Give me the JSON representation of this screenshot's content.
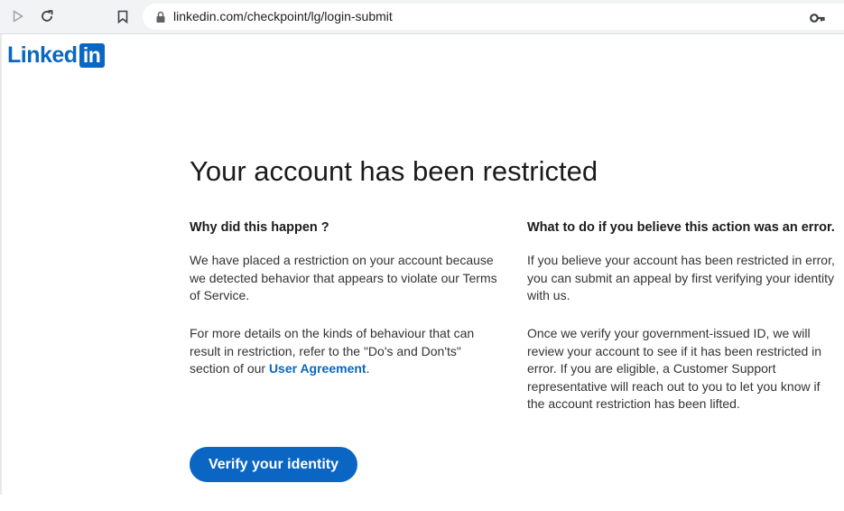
{
  "browser": {
    "url": "linkedin.com/checkpoint/lg/login-submit",
    "icons": [
      "play-icon",
      "reload-icon",
      "bookmark-icon",
      "lock-icon",
      "key-icon"
    ]
  },
  "logo": {
    "text": "Linked",
    "box_text": "in",
    "color": "#0a66c2"
  },
  "main": {
    "title": "Your account has been restricted",
    "left": {
      "heading": "Why did this happen ?",
      "para1": "We have placed a restriction on your account because we detected behavior that appears to violate our Terms of Service.",
      "para2_prefix": "For more details on the kinds of behaviour that can result in restriction, refer to the \"Do's and Don'ts\" section of our ",
      "para2_link": "User Agreement",
      "para2_suffix": "."
    },
    "right": {
      "heading": "What to do if you believe this action was an error.",
      "para1": "If you believe your account has been restricted in error, you can submit an appeal by first verifying your identity with us.",
      "para2": "Once we verify your government-issued ID, we will review your account to see if it has been restricted in error. If you are eligible, a Customer Support representative will reach out to you to let you know if the account restriction has been lifted."
    },
    "button_label": "Verify your identity",
    "accent_color": "#0a66c2"
  }
}
